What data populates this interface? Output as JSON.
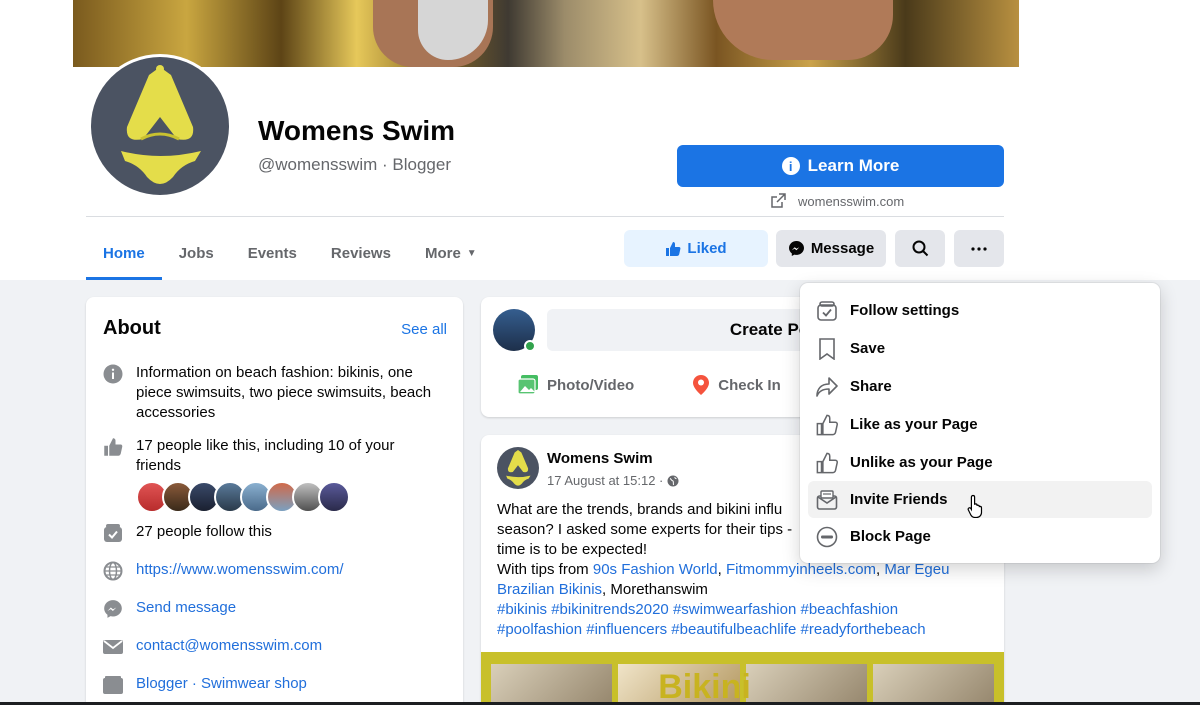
{
  "page": {
    "name": "Womens Swim",
    "handle_category": "@womensswim · Blogger"
  },
  "cta": {
    "learn_more": "Learn More",
    "website": "womensswim.com"
  },
  "tabs": [
    {
      "label": "Home",
      "active": true
    },
    {
      "label": "Jobs"
    },
    {
      "label": "Events"
    },
    {
      "label": "Reviews"
    },
    {
      "label": "More"
    }
  ],
  "actions": {
    "liked": "Liked",
    "message": "Message"
  },
  "about": {
    "title": "About",
    "see_all": "See all",
    "description": "Information on beach fashion: bikinis, one piece swimsuits, two piece swimsuits, beach accessories",
    "likes": "17 people like this, including 10 of your friends",
    "follows": "27 people follow this",
    "website": "https://www.womensswim.com/",
    "send_message": "Send message",
    "email": "contact@womensswim.com",
    "categories": "Blogger · Swimwear shop"
  },
  "create_post": {
    "label": "Create Po",
    "photo_video": "Photo/Video",
    "check_in": "Check In"
  },
  "post": {
    "author": "Womens Swim",
    "date": "17 August at 15:12 ·",
    "line1": "What are the trends, brands and bikini influ",
    "line2": "season? I asked some experts for their tips -",
    "line3": "time is to be expected!",
    "tips_prefix": "With tips from ",
    "tip1": "90s Fashion World",
    "tip2": "Fitmommyinheels.com",
    "tip3": "Mar Egeu",
    "tip4": "Brazilian Bikinis",
    "tips_suffix": ", Morethanswim",
    "hashtags1": "#bikinis #bikinitrends2020 #swimwearfashion #beachfashion",
    "hashtags2": "#poolfashion #influencers #beautifulbeachlife #readyforthebeach",
    "image_word": "Bikini"
  },
  "menu": [
    {
      "label": "Follow settings",
      "icon": "follow-settings-icon"
    },
    {
      "label": "Save",
      "icon": "bookmark-icon"
    },
    {
      "label": "Share",
      "icon": "share-icon"
    },
    {
      "label": "Like as your Page",
      "icon": "thumbs-up-icon"
    },
    {
      "label": "Unlike as your Page",
      "icon": "thumbs-up-icon"
    },
    {
      "label": "Invite Friends",
      "icon": "invite-envelope-icon",
      "hovered": true
    },
    {
      "label": "Block Page",
      "icon": "block-icon"
    }
  ],
  "colors": {
    "accent": "#1b74e4",
    "link": "#216fdb",
    "liked_bg": "#e7f3ff"
  }
}
